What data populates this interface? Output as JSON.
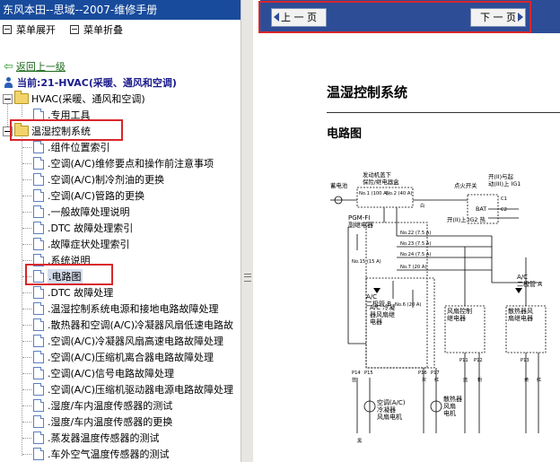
{
  "left_panel": {
    "title": "东风本田--思域--2007-维修手册",
    "menu": {
      "expand": "菜单展开",
      "collapse": "菜单折叠"
    },
    "back_link": "返回上一级",
    "current": "当前:21-HVAC(采暖、通风和空调)",
    "tree": {
      "root": "HVAC(采暖、通风和空调)",
      "root_child": ".专用工具",
      "folder": "温湿控制系统",
      "items": [
        ".组件位置索引",
        ".空调(A/C)维修要点和操作前注意事项",
        ".空调(A/C)制冷剂油的更换",
        ".空调(A/C)管路的更换",
        ".一般故障处理说明",
        ".DTC 故障处理索引",
        ".故障症状处理索引",
        ".系统说明",
        ".电路图",
        ".DTC 故障处理",
        ".温湿控制系统电源和接地电路故障处理",
        ".散热器和空调(A/C)冷凝器风扇低速电路故",
        ".空调(A/C)冷凝器风扇高速电路故障处理",
        ".空调(A/C)压缩机离合器电路故障处理",
        ".空调(A/C)信号电路故障处理",
        ".空调(A/C)压缩机驱动器电源电路故障处理",
        ".湿度/车内温度传感器的测试",
        ".湿度/车内温度传感器的更换",
        ".蒸发器温度传感器的测试",
        ".车外空气温度传感器的测试"
      ],
      "selected_index": 8
    }
  },
  "right_panel": {
    "prev_page": "上 一 页",
    "next_page": "下 一 页",
    "doc_title": "温湿控制系统",
    "doc_subtitle": "电路图",
    "diagram": {
      "battery": "蓄电池",
      "fusebox": "发动机盖下\n保险/继电器盒",
      "ignition": "点火开关",
      "ig_switch": "开(II)与起\n动(III)上 IG1",
      "ig2": "开(II)上 IG2 热",
      "bat": "BAT",
      "pgm_fi": "PGM-FI\n副继电器",
      "ac_diode_b": "A/C\n二极管 B",
      "ac_diode_a": "A/C\n二极管 A",
      "ac_condenser_relay": "A/C 冷凝\n器风扇继\n电器",
      "fan_control_relay": "风扇控制\n继电器",
      "radiator_fan_relay": "散热器风\n扇继电器",
      "ac_condenser_motor": "空调(A/C)\n冷凝器\n风扇电机",
      "radiator_motor": "散热器\n风扇\n电机",
      "fuses": [
        "No.1 (100 A)",
        "No.2 (40 A)",
        "No.22 (7.5 A)",
        "No.23 (7.5 A)",
        "No.24 (7.5 A)",
        "No.7 (20 A)",
        "No.15 (15 A)",
        "No.6 (20 A)"
      ],
      "wire_colors": [
        "白",
        "蓝",
        "灰",
        "红",
        "蓝",
        "粉",
        "黑",
        "黄",
        "红"
      ],
      "pins": [
        "P14",
        "P15",
        "P16",
        "P17",
        "C1",
        "C2",
        "P11",
        "P12",
        "P13"
      ]
    }
  },
  "colors": {
    "title_bar": "#184b9c",
    "nav_bar": "#2d4d96",
    "highlight_box": "#d9262b",
    "link": "#1d6a1d"
  }
}
